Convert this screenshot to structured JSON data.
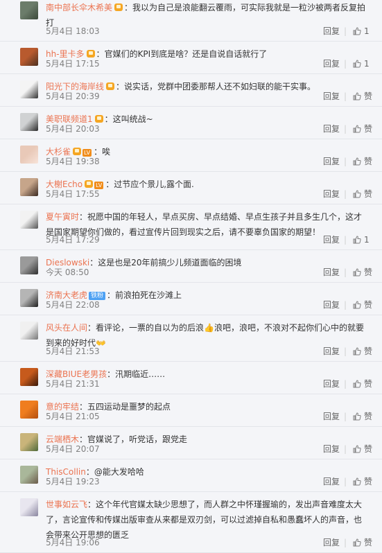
{
  "comments": [
    {
      "user": "南中部长伞木希美",
      "badge": "vip",
      "text": "我以为自己是浪能翻云覆雨，可实际我就是一粒沙被两者反复拍打",
      "time": "5月4日 18:03",
      "reply": "回复",
      "like": "1",
      "avatar_colors": [
        "#6b7c6a",
        "#3c4a3b"
      ]
    },
    {
      "user": "hh-里卡多",
      "badge": "vip",
      "text": "官媒们的KPI到底是啥？还是自说自话就行了",
      "time": "5月4日 17:15",
      "reply": "回复",
      "like": "1",
      "avatar_colors": [
        "#b85a2e",
        "#4c3020"
      ]
    },
    {
      "user": "阳光下的海岸线",
      "badge": "vip",
      "text": "说实话，党群中团委那帮人还不如妇联的能干实事。",
      "time": "5月4日 20:39",
      "reply": "回复",
      "like": "赞",
      "avatar_colors": [
        "#f4f4f4",
        "#333333"
      ]
    },
    {
      "user": "美职联频道1",
      "badge": "vip",
      "text": "这叫统战~",
      "time": "5月4日 20:03",
      "reply": "回复",
      "like": "赞",
      "avatar_colors": [
        "#d0d2d3",
        "#2a2a2a"
      ]
    },
    {
      "user": "大杉雀",
      "badge": "vip-lvl",
      "level": "LV",
      "text": "唉",
      "time": "5月4日 19:38",
      "reply": "回复",
      "like": "赞",
      "avatar_colors": [
        "#e9c9b8",
        "#f7e3d9"
      ]
    },
    {
      "user": "大榭Echo",
      "badge": "vip-lvl",
      "level": "LV",
      "text": "过节应个景儿,露个面.",
      "time": "5月4日 17:55",
      "reply": "回复",
      "like": "赞",
      "avatar_colors": [
        "#c6a58a",
        "#3b2a22"
      ]
    },
    {
      "user": "夏午寅时",
      "badge": "none",
      "text": "祝愿中国的年轻人，早点买房、早点结婚、早点生孩子并且多生几个，这才是国家期望你们做的，看过宣传片回到现实之后，请不要辜负国家的期望！",
      "time": "5月4日 17:29",
      "reply": "回复",
      "like": "1",
      "avatar_colors": [
        "#f2f2f2",
        "#555555"
      ]
    },
    {
      "user": "Dieslowski",
      "badge": "none",
      "text": "这是也是20年前搞少儿频道面临的困境",
      "time": "今天 08:50",
      "reply": "回复",
      "like": "赞",
      "avatar_colors": [
        "#9a9a9a",
        "#2f2f2f"
      ]
    },
    {
      "user": "济南大老虎",
      "badge": "fan",
      "fan_label": "铁粉",
      "text": "前浪拍死在沙滩上",
      "time": "5月4日 22:08",
      "reply": "回复",
      "like": "赞",
      "avatar_colors": [
        "#b5b5b5",
        "#1f1f1f"
      ]
    },
    {
      "user": "风头在人间",
      "badge": "none",
      "text": "看评论，一票的自以为的后浪👍浪吧，浪吧，不浪对不起你们心中的就要到来的好时代👐",
      "time": "5月4日 21:53",
      "reply": "回复",
      "like": "赞",
      "avatar_colors": [
        "#f0f0f0",
        "#777777"
      ]
    },
    {
      "user": "深藏BIUE老男孩",
      "badge": "none",
      "text": "汛期临近……",
      "time": "5月4日 21:31",
      "reply": "回复",
      "like": "赞",
      "avatar_colors": [
        "#c65a1c",
        "#3a1a0a"
      ]
    },
    {
      "user": "意的牢结",
      "badge": "none",
      "text": "五四运动是噩梦的起点",
      "time": "5月4日 21:05",
      "reply": "回复",
      "like": "赞",
      "avatar_colors": [
        "#ef7d1f",
        "#b34f10"
      ]
    },
    {
      "user": "云端栖木",
      "badge": "none",
      "text": "官媒说了，听党话，跟党走",
      "time": "5月4日 20:07",
      "reply": "回复",
      "like": "赞",
      "avatar_colors": [
        "#c9b47a",
        "#4f6a3a"
      ]
    },
    {
      "user": "ThisCollin",
      "badge": "none",
      "text": "@能大发哈哈",
      "time": "5月4日 19:23",
      "reply": "回复",
      "like": "赞",
      "avatar_colors": [
        "#a9b79a",
        "#6b5b4a"
      ]
    },
    {
      "user": "世事如云飞",
      "badge": "none",
      "text": "这个年代官媒太缺少思想了，而人群之中怀瑾握瑜的，发出声音难度太大了，言论宣传和传媒出版审查从来都是双刃剑，可以过滤掉自私和愚蠢坏人的声音，也会带来公开思想的匮乏",
      "time": "5月4日 19:06",
      "reply": "回复",
      "like": "赞",
      "avatar_colors": [
        "#e8e6ef",
        "#8a86a0"
      ]
    }
  ]
}
